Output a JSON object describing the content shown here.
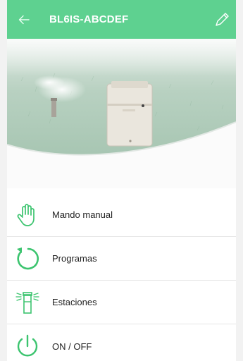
{
  "header": {
    "title": "BL6IS-ABCDEF",
    "background": "#5ed190",
    "back_icon": "arrow-left-icon",
    "edit_icon": "pencil-icon"
  },
  "menu": {
    "accent": "#3cc46f",
    "items": [
      {
        "label": "Mando manual",
        "icon": "hand-icon"
      },
      {
        "label": "Programas",
        "icon": "circular-arrow-icon"
      },
      {
        "label": "Estaciones",
        "icon": "sprinkler-station-icon"
      },
      {
        "label": "ON / OFF",
        "icon": "power-icon"
      }
    ]
  }
}
